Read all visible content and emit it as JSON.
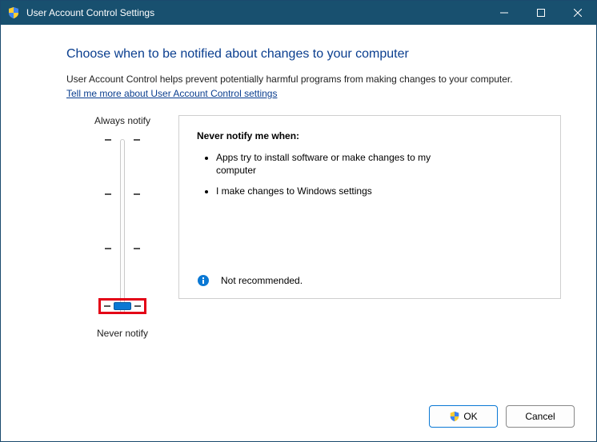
{
  "titlebar": {
    "title": "User Account Control Settings"
  },
  "heading": "Choose when to be notified about changes to your computer",
  "description": "User Account Control helps prevent potentially harmful programs from making changes to your computer.",
  "link": "Tell me more about User Account Control settings",
  "slider": {
    "top_label": "Always notify",
    "bottom_label": "Never notify"
  },
  "panel": {
    "title": "Never notify me when:",
    "items": [
      "Apps try to install software or make changes to my computer",
      "I make changes to Windows settings"
    ],
    "info": "Not recommended."
  },
  "buttons": {
    "ok": "OK",
    "cancel": "Cancel"
  }
}
